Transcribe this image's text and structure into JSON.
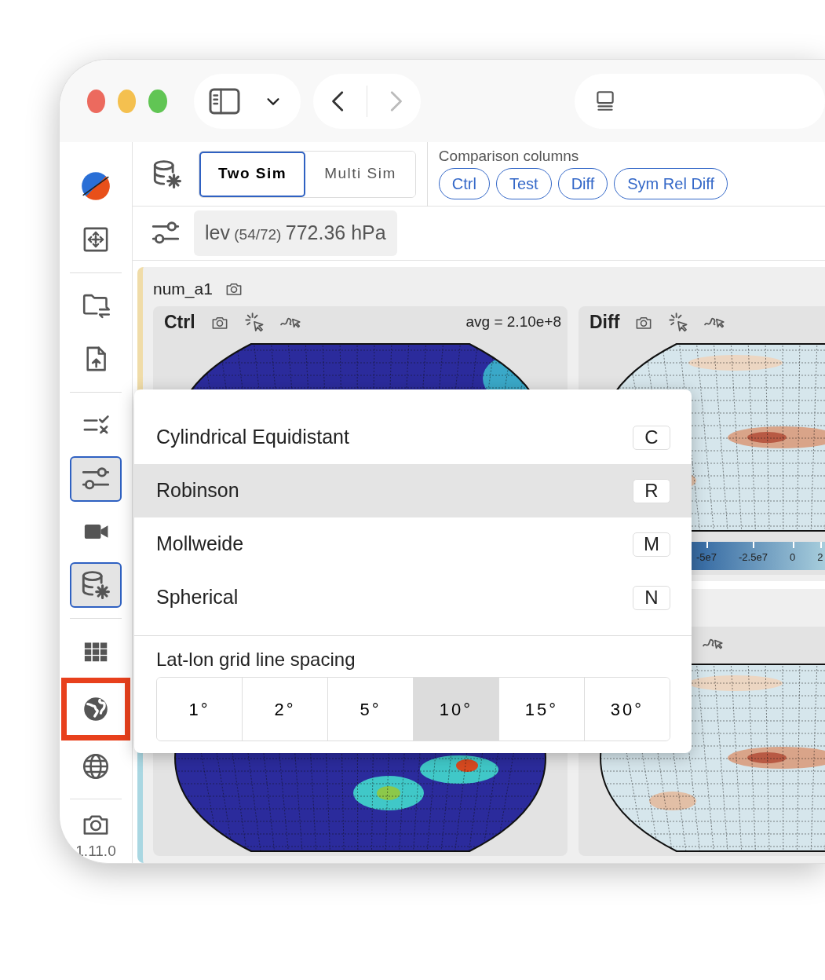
{
  "titlebar": {
    "back": {
      "disabled": false
    },
    "forward": {
      "disabled": true
    }
  },
  "sidebar": {
    "groups": [
      [
        {
          "selected": false,
          "highlighted": false
        },
        {
          "selected": false,
          "highlighted": false
        }
      ],
      [
        {
          "selected": false,
          "highlighted": false
        },
        {
          "selected": false,
          "highlighted": false
        }
      ],
      [
        {
          "selected": false,
          "highlighted": false
        },
        {
          "selected": true,
          "highlighted": false
        },
        {
          "selected": false,
          "highlighted": false
        },
        {
          "selected": true,
          "highlighted": false
        }
      ],
      [
        {
          "selected": false,
          "highlighted": false
        },
        {
          "selected": false,
          "highlighted": true
        },
        {
          "selected": false,
          "highlighted": false
        }
      ]
    ],
    "version": "1.11.0"
  },
  "mode_tabs": [
    {
      "label": "Two Sim",
      "selected": true
    },
    {
      "label": "Multi Sim",
      "selected": false
    }
  ],
  "comparison_columns": {
    "label": "Comparison columns",
    "chips": [
      "Ctrl",
      "Test",
      "Diff",
      "Sym Rel Diff"
    ]
  },
  "level": {
    "name": "lev",
    "index": "(54/72)",
    "value": "772.36 hPa"
  },
  "plot_groups": [
    {
      "title": "num_a1",
      "color": "#f0dca8",
      "panels": [
        {
          "title": "Ctrl",
          "stat": "avg = 2.10e+8",
          "kind": "sequential"
        },
        {
          "title": "Diff",
          "kind": "diverging",
          "colorbar_labels": [
            "-5e7",
            "-2.5e7",
            "0",
            "2"
          ]
        }
      ]
    },
    {
      "color": "#a9d7e2",
      "panels": [
        {
          "kind": "sequential"
        },
        {
          "kind": "diverging"
        }
      ]
    }
  ],
  "projection_menu": {
    "items": [
      {
        "label": "Cylindrical Equidistant",
        "shortcut": "C",
        "selected": false
      },
      {
        "label": "Robinson",
        "shortcut": "R",
        "selected": true
      },
      {
        "label": "Mollweide",
        "shortcut": "M",
        "selected": false
      },
      {
        "label": "Spherical",
        "shortcut": "N",
        "selected": false
      }
    ],
    "grid_spacing": {
      "label": "Lat-lon grid line spacing",
      "options": [
        {
          "label": "1°",
          "selected": false
        },
        {
          "label": "2°",
          "selected": false
        },
        {
          "label": "5°",
          "selected": false
        },
        {
          "label": "10°",
          "selected": true
        },
        {
          "label": "15°",
          "selected": false
        },
        {
          "label": "30°",
          "selected": false
        }
      ]
    }
  }
}
